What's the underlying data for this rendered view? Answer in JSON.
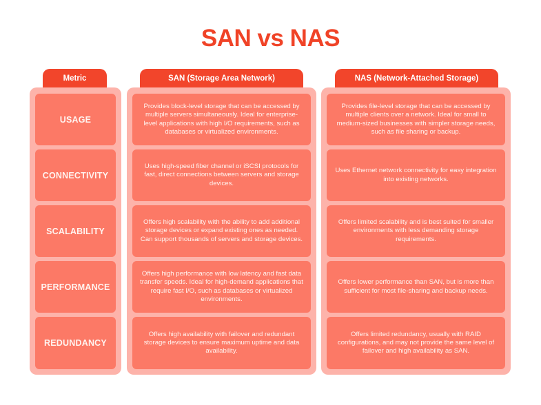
{
  "title": "SAN vs NAS",
  "colors": {
    "accent": "#f2452b",
    "frame": "#fdb3aa",
    "cell": "#fc7966",
    "cell_text": "#fff3ef"
  },
  "headers": {
    "metric": "Metric",
    "san": "SAN (Storage Area Network)",
    "nas": "NAS (Network-Attached Storage)"
  },
  "rows": [
    {
      "metric": "USAGE",
      "san": "Provides block-level storage that can be accessed by multiple servers simultaneously. Ideal for enterprise-level applications with high I/O requirements, such as databases or virtualized environments.",
      "nas": "Provides file-level storage that can be accessed by multiple clients over a network. Ideal for small to medium-sized businesses with simpler storage needs, such as file sharing or backup."
    },
    {
      "metric": "CONNECTIVITY",
      "san": "Uses high-speed fiber channel or iSCSI protocols for fast, direct connections between servers and storage devices.",
      "nas": "Uses Ethernet network connectivity for easy integration into existing networks."
    },
    {
      "metric": "SCALABILITY",
      "san": "Offers high scalability with the ability to add additional storage devices or expand existing ones as needed. Can support thousands of servers and storage devices.",
      "nas": "Offers limited scalability and is best suited for smaller environments with less demanding storage requirements."
    },
    {
      "metric": "PERFORMANCE",
      "san": "Offers high performance with low latency and fast data transfer speeds. Ideal for high-demand applications that require fast I/O, such as databases or virtualized environments.",
      "nas": "Offers lower performance than SAN, but is more than sufficient for most file-sharing and backup needs."
    },
    {
      "metric": "REDUNDANCY",
      "san": "Offers high availability with failover and redundant storage devices to ensure maximum uptime and data availability.",
      "nas": "Offers limited redundancy, usually with RAID configurations, and may not provide the same level of failover and high availability as SAN."
    }
  ]
}
